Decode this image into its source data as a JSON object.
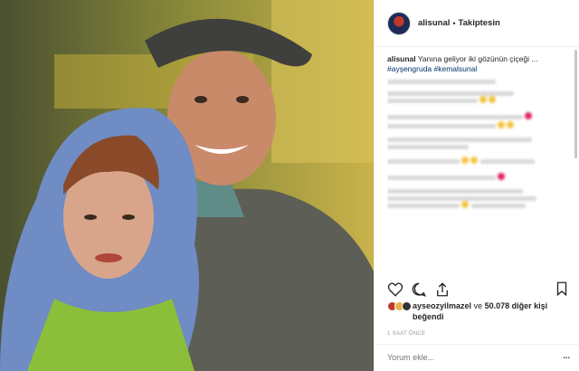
{
  "header": {
    "username": "alisunal",
    "separator": "•",
    "follow_status": "Takiptesin"
  },
  "caption": {
    "username": "alisunal",
    "text": "Yanına geliyor iki gözünün çiçeği ...",
    "tags": "#ayşengruda #kemalsunal"
  },
  "likes": {
    "username": "ayseozyilmazel",
    "middle": "ve",
    "count": "50.078",
    "suffix": "diğer kişi beğendi"
  },
  "time": "1 SAAT ÖNCE",
  "comment_box": {
    "placeholder": "Yorum ekle..."
  },
  "more_label": "...",
  "icons": {
    "like": "heart-icon",
    "comment": "comment-icon",
    "share": "share-icon",
    "save": "bookmark-icon"
  }
}
